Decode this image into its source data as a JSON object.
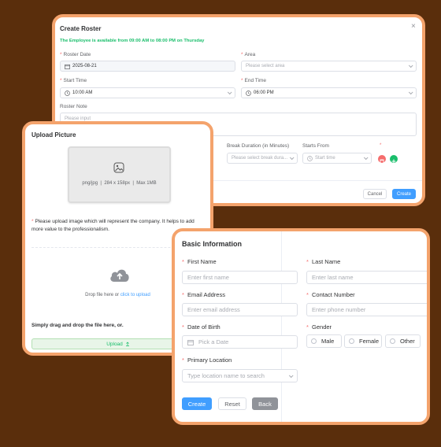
{
  "roster": {
    "title": "Create Roster",
    "availability": "The Employee is available from 09:00 AM to 08:00 PM on Thursday",
    "roster_date_label": "Roster Date",
    "roster_date_value": "2025-08-21",
    "area_label": "Area",
    "area_placeholder": "Please select area",
    "start_time_label": "Start Time",
    "start_time_value": "10:00 AM",
    "end_time_label": "End Time",
    "end_time_value": "06:00 PM",
    "note_label": "Roster Note",
    "note_placeholder": "Please input",
    "break_duration_label": "Break Duration (in Minutes)",
    "break_duration_placeholder": "Please select break dura...",
    "starts_from_label": "Starts From",
    "starts_from_placeholder": "Start time",
    "cancel_label": "Cancel",
    "create_label": "Create",
    "close_glyph": "×"
  },
  "upload": {
    "title": "Upload Picture",
    "spec": "png/jpg  |  284 x 158px  |  Max 1MB",
    "note": "Please upload image which will represent the company. It helps to add more value to the professionalism.",
    "drop_text": "Drop file here or",
    "drop_link": "click to upload",
    "drag_text": "Simply drag and drop the file here, or.",
    "upload_button": "Upload"
  },
  "basic": {
    "title": "Basic Information",
    "first_name_label": "First Name",
    "first_name_placeholder": "Enter first name",
    "last_name_label": "Last Name",
    "last_name_placeholder": "Enter last name",
    "email_label": "Email Address",
    "email_placeholder": "Enter email address",
    "contact_label": "Contact Number",
    "contact_placeholder": "Enter phone number",
    "dob_label": "Date of Birth",
    "dob_placeholder": "Pick a Date",
    "gender_label": "Gender",
    "gender_options": [
      "Male",
      "Female",
      "Other"
    ],
    "location_label": "Primary Location",
    "location_placeholder": "Type location name to search",
    "create_label": "Create",
    "reset_label": "Reset",
    "back_label": "Back"
  },
  "colors": {
    "accent": "#f4a36c",
    "background": "#5a2e0c",
    "primary": "#409eff",
    "success": "#19be6b",
    "danger": "#f56c6c"
  },
  "icons": [
    "close-icon",
    "calendar-icon",
    "clock-icon",
    "chevron-down-icon",
    "delete-icon",
    "add-icon",
    "image-icon",
    "cloud-upload-icon"
  ]
}
